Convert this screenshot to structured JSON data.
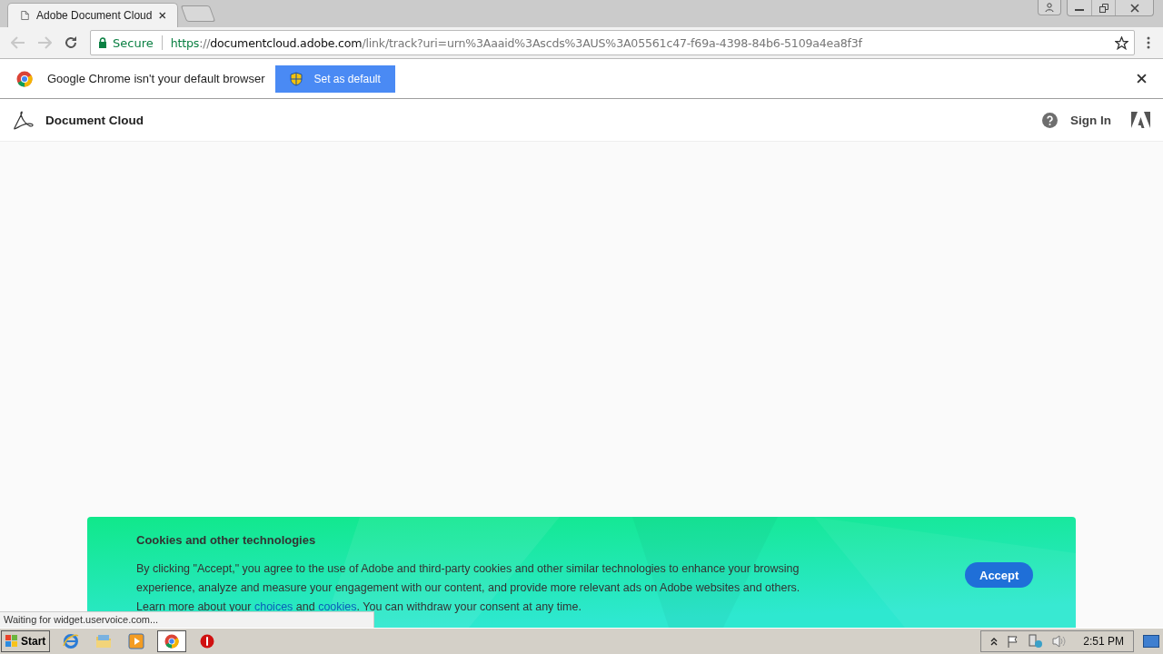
{
  "tabs": [
    {
      "title": "Adobe Document Cloud",
      "selected": true
    }
  ],
  "address_bar": {
    "security": "Secure",
    "scheme": "https",
    "separator": "://",
    "host": "documentcloud.adobe.com",
    "path": "/link/track?uri=urn%3Aaaid%3Ascds%3AUS%3A05561c47-f69a-4398-84b6-5109a4ea8f3f"
  },
  "infobar": {
    "message": "Google Chrome isn't your default browser",
    "button": "Set as default"
  },
  "site_header": {
    "brand": "Document Cloud",
    "sign_in": "Sign In"
  },
  "cookie_banner": {
    "title": "Cookies and other technologies",
    "paragraph": [
      {
        "kind": "text",
        "text": "By clicking \"Accept,\" you agree to the use of Adobe and third-party cookies and other similar technologies to enhance your browsing experience, analyze and measure your engagement with our content, and provide more relevant ads on Adobe websites and others. Learn more about your "
      },
      {
        "kind": "link",
        "text": "choices"
      },
      {
        "kind": "text",
        "text": " and "
      },
      {
        "kind": "link",
        "text": "cookies"
      },
      {
        "kind": "text",
        "text": ". You can withdraw your consent at any time."
      }
    ],
    "button": "Accept"
  },
  "status_bubble": "Waiting for widget.uservoice.com...",
  "taskbar": {
    "start": "Start",
    "apps": [
      {
        "kind": "ie",
        "selected": false
      },
      {
        "kind": "folder",
        "selected": false
      },
      {
        "kind": "media",
        "selected": false
      },
      {
        "kind": "chrome",
        "selected": true
      },
      {
        "kind": "stop",
        "selected": false
      }
    ],
    "clock": "2:51 PM"
  }
}
